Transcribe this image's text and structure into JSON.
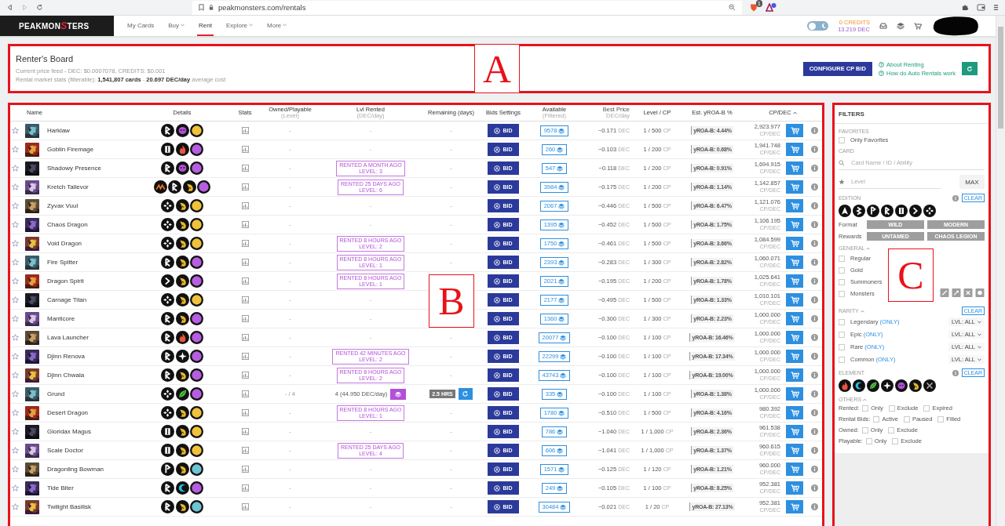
{
  "browser": {
    "url": "peakmonsters.com/rentals",
    "forward_disabled": true,
    "shield_badge": "1"
  },
  "nav": {
    "logo": {
      "before": "PEAKMON",
      "mark": "S",
      "after": "TERS"
    },
    "items": [
      {
        "label": "My Cards",
        "dropdown": false,
        "selected": false
      },
      {
        "label": "Buy",
        "dropdown": true,
        "selected": false
      },
      {
        "label": "Rent",
        "dropdown": false,
        "selected": true
      },
      {
        "label": "Explore",
        "dropdown": true,
        "selected": false
      },
      {
        "label": "More",
        "dropdown": true,
        "selected": false
      }
    ],
    "theme_toggle_on": false,
    "credits": "0 CREDITS",
    "dec": "13.219 DEC"
  },
  "board": {
    "annotation": "A",
    "title": "Renter's Board",
    "price_feed": "Current price feed - DEC: $0.0007078, CREDITS: $0.001",
    "market_stats": "Rental market stats (filterable): **1,541,807 cards** - **20.697 DEC/day** average cost",
    "configure_button": "CONFIGURE CP BID",
    "links": [
      "About Renting",
      "How do Auto Rentals work"
    ]
  },
  "table": {
    "annotation": "B",
    "columns": [
      {
        "label": "Name",
        "sorted": false
      },
      {
        "label": "Details",
        "sorted": false
      },
      {
        "label": "Stats",
        "sorted": false
      },
      {
        "label": "Owned/Playable",
        "sub": "(Level)",
        "sorted": false
      },
      {
        "label": "Lvl Rented",
        "sub": "(DEC/day)",
        "sorted": false
      },
      {
        "label": "Remaining (days)",
        "sorted": false
      },
      {
        "label": "Bids Settings",
        "sorted": false
      },
      {
        "label": "Available",
        "sub": "(Filtered)",
        "sorted": false
      },
      {
        "label": "Best Price",
        "sub": "DEC/day",
        "sorted": false
      },
      {
        "label": "Level / CP",
        "sorted": false
      },
      {
        "label": "Est. yROA-B %",
        "sorted": false
      },
      {
        "label": "CP/DEC",
        "sorted": true
      }
    ],
    "rows": [
      {
        "favorite": false,
        "name": "Harklaw",
        "details": [
          {
            "kind": "rune"
          },
          {
            "kind": "death"
          },
          {
            "kind": "rarity",
            "color": "#f0c23b"
          }
        ],
        "owned": "-",
        "rented": {
          "kind": "none",
          "text": "-"
        },
        "remaining": {
          "kind": "none",
          "text": "-"
        },
        "bid": "BID",
        "available": "9578",
        "price": "~0.171",
        "price_unit": "DEC",
        "level_cp": "1 / 500",
        "level_unit": "CP",
        "yroa": "yROA-B: 4.44%",
        "cp_dec": "2,923.977",
        "cp_dec_unit": "CP/DEC"
      },
      {
        "favorite": false,
        "name": "Goblin Firemage",
        "details": [
          {
            "kind": "bars"
          },
          {
            "kind": "fire"
          },
          {
            "kind": "rarity",
            "color": "#b65ee0"
          }
        ],
        "owned": "-",
        "rented": {
          "kind": "none",
          "text": "-"
        },
        "remaining": {
          "kind": "none",
          "text": "-"
        },
        "bid": "BID",
        "available": "260",
        "price": "~0.103",
        "price_unit": "DEC",
        "level_cp": "1 / 200",
        "level_unit": "CP",
        "yroa": "yROA-B: 0.68%",
        "cp_dec": "1,941.748",
        "cp_dec_unit": "CP/DEC"
      },
      {
        "favorite": false,
        "name": "Shadowy Presence",
        "details": [
          {
            "kind": "rune"
          },
          {
            "kind": "death"
          },
          {
            "kind": "rarity",
            "color": "#b65ee0"
          }
        ],
        "owned": "-",
        "rented": {
          "kind": "badge",
          "text": "RENTED A MONTH AGO",
          "detail": "LEVEL: 3"
        },
        "remaining": {
          "kind": "none",
          "text": "-"
        },
        "bid": "BID",
        "available": "547",
        "price": "~0.118",
        "price_unit": "DEC",
        "level_cp": "1 / 200",
        "level_unit": "CP",
        "yroa": "yROA-B: 0.91%",
        "cp_dec": "1,694.915",
        "cp_dec_unit": "CP/DEC"
      },
      {
        "favorite": false,
        "name": "Kretch Tallevor",
        "details": [
          {
            "kind": "tribal"
          },
          {
            "kind": "rune"
          },
          {
            "kind": "dragon"
          },
          {
            "kind": "rarity",
            "color": "#b65ee0"
          }
        ],
        "owned": "-",
        "rented": {
          "kind": "badge",
          "text": "RENTED 25 DAYS AGO",
          "detail": "LEVEL: 6"
        },
        "remaining": {
          "kind": "none",
          "text": "-"
        },
        "bid": "BID",
        "available": "3984",
        "price": "~0.175",
        "price_unit": "DEC",
        "level_cp": "1 / 200",
        "level_unit": "CP",
        "yroa": "yROA-B: 1.14%",
        "cp_dec": "1,142.857",
        "cp_dec_unit": "CP/DEC"
      },
      {
        "favorite": false,
        "name": "Zyvax Vuul",
        "details": [
          {
            "kind": "diamond"
          },
          {
            "kind": "dragon"
          },
          {
            "kind": "rarity",
            "color": "#f0c23b"
          }
        ],
        "owned": "-",
        "rented": {
          "kind": "none",
          "text": "-"
        },
        "remaining": {
          "kind": "none",
          "text": "-"
        },
        "bid": "BID",
        "available": "2067",
        "price": "~0.446",
        "price_unit": "DEC",
        "level_cp": "1 / 500",
        "level_unit": "CP",
        "yroa": "yROA-B: 6.47%",
        "cp_dec": "1,121.076",
        "cp_dec_unit": "CP/DEC"
      },
      {
        "favorite": false,
        "name": "Chaos Dragon",
        "details": [
          {
            "kind": "diamond"
          },
          {
            "kind": "dragon"
          },
          {
            "kind": "rarity",
            "color": "#f0c23b"
          }
        ],
        "owned": "-",
        "rented": {
          "kind": "none",
          "text": "-"
        },
        "remaining": {
          "kind": "none",
          "text": "-"
        },
        "bid": "BID",
        "available": "1395",
        "price": "~0.452",
        "price_unit": "DEC",
        "level_cp": "1 / 500",
        "level_unit": "CP",
        "yroa": "yROA-B: 1.75%",
        "cp_dec": "1,106.195",
        "cp_dec_unit": "CP/DEC"
      },
      {
        "favorite": false,
        "name": "Void Dragon",
        "details": [
          {
            "kind": "diamond"
          },
          {
            "kind": "dragon"
          },
          {
            "kind": "rarity",
            "color": "#f0c23b"
          }
        ],
        "owned": "-",
        "rented": {
          "kind": "badge",
          "text": "RENTED 8 HOURS AGO",
          "detail": "LEVEL: 2"
        },
        "remaining": {
          "kind": "none",
          "text": "-"
        },
        "bid": "BID",
        "available": "1750",
        "price": "~0.461",
        "price_unit": "DEC",
        "level_cp": "1 / 500",
        "level_unit": "CP",
        "yroa": "yROA-B: 3.66%",
        "cp_dec": "1,084.599",
        "cp_dec_unit": "CP/DEC"
      },
      {
        "favorite": false,
        "name": "Fire Spitter",
        "details": [
          {
            "kind": "rune"
          },
          {
            "kind": "dragon"
          },
          {
            "kind": "rarity",
            "color": "#b65ee0"
          }
        ],
        "owned": "-",
        "rented": {
          "kind": "badge",
          "text": "RENTED 8 HOURS AGO",
          "detail": "LEVEL: 1"
        },
        "remaining": {
          "kind": "none",
          "text": "-"
        },
        "bid": "BID",
        "available": "2393",
        "price": "~0.283",
        "price_unit": "DEC",
        "level_cp": "1 / 300",
        "level_unit": "CP",
        "yroa": "yROA-B: 2.82%",
        "cp_dec": "1,060.071",
        "cp_dec_unit": "CP/DEC"
      },
      {
        "favorite": false,
        "name": "Dragon Spirit",
        "details": [
          {
            "kind": "chevron"
          },
          {
            "kind": "dragon"
          },
          {
            "kind": "rarity",
            "color": "#b65ee0"
          }
        ],
        "owned": "-",
        "rented": {
          "kind": "badge",
          "text": "RENTED 8 HOURS AGO",
          "detail": "LEVEL: 1"
        },
        "remaining": {
          "kind": "hidden"
        },
        "bid": "BID",
        "available": "2021",
        "price": "~0.195",
        "price_unit": "DEC",
        "level_cp": "1 / 200",
        "level_unit": "CP",
        "yroa": "yROA-B: 1.78%",
        "cp_dec": "1,025.641",
        "cp_dec_unit": "CP/DEC"
      },
      {
        "favorite": false,
        "name": "Carnage Titan",
        "details": [
          {
            "kind": "diamond"
          },
          {
            "kind": "dragon"
          },
          {
            "kind": "rarity",
            "color": "#f0c23b"
          }
        ],
        "owned": "-",
        "rented": {
          "kind": "none",
          "text": "-"
        },
        "remaining": {
          "kind": "hidden"
        },
        "bid": "BID",
        "available": "2177",
        "price": "~0.495",
        "price_unit": "DEC",
        "level_cp": "1 / 500",
        "level_unit": "CP",
        "yroa": "yROA-B: 1.33%",
        "cp_dec": "1,010.101",
        "cp_dec_unit": "CP/DEC"
      },
      {
        "favorite": false,
        "name": "Manticore",
        "details": [
          {
            "kind": "rune"
          },
          {
            "kind": "dragon"
          },
          {
            "kind": "rarity",
            "color": "#b65ee0"
          }
        ],
        "owned": "-",
        "rented": {
          "kind": "none",
          "text": "-"
        },
        "remaining": {
          "kind": "hidden"
        },
        "bid": "BID",
        "available": "1360",
        "price": "~0.300",
        "price_unit": "DEC",
        "level_cp": "1 / 300",
        "level_unit": "CP",
        "yroa": "yROA-B: 2.23%",
        "cp_dec": "1,000.000",
        "cp_dec_unit": "CP/DEC"
      },
      {
        "favorite": false,
        "name": "Lava Launcher",
        "details": [
          {
            "kind": "rune"
          },
          {
            "kind": "fire"
          },
          {
            "kind": "rarity",
            "color": "#b65ee0"
          }
        ],
        "owned": "-",
        "rented": {
          "kind": "none",
          "text": "-"
        },
        "remaining": {
          "kind": "none",
          "text": "-"
        },
        "bid": "BID",
        "available": "20077",
        "price": "~0.100",
        "price_unit": "DEC",
        "level_cp": "1 / 100",
        "level_unit": "CP",
        "yroa": "yROA-B: 16.46%",
        "cp_dec": "1,000.000",
        "cp_dec_unit": "CP/DEC"
      },
      {
        "favorite": false,
        "name": "Djinn Renova",
        "details": [
          {
            "kind": "rune"
          },
          {
            "kind": "life"
          },
          {
            "kind": "rarity",
            "color": "#b65ee0"
          }
        ],
        "owned": "-",
        "rented": {
          "kind": "badge",
          "text": "RENTED 42 MINUTES AGO",
          "detail": "LEVEL: 2"
        },
        "remaining": {
          "kind": "none",
          "text": "-"
        },
        "bid": "BID",
        "available": "22299",
        "price": "~0.100",
        "price_unit": "DEC",
        "level_cp": "1 / 100",
        "level_unit": "CP",
        "yroa": "yROA-B: 17.34%",
        "cp_dec": "1,000.000",
        "cp_dec_unit": "CP/DEC"
      },
      {
        "favorite": false,
        "name": "Djinn Chwala",
        "details": [
          {
            "kind": "rune"
          },
          {
            "kind": "dragon"
          },
          {
            "kind": "rarity",
            "color": "#b65ee0"
          }
        ],
        "owned": "-",
        "rented": {
          "kind": "badge",
          "text": "RENTED 8 HOURS AGO",
          "detail": "LEVEL: 2"
        },
        "remaining": {
          "kind": "none",
          "text": "-"
        },
        "bid": "BID",
        "available": "43743",
        "price": "~0.100",
        "price_unit": "DEC",
        "level_cp": "1 / 100",
        "level_unit": "CP",
        "yroa": "yROA-B: 19.00%",
        "cp_dec": "1,000.000",
        "cp_dec_unit": "CP/DEC"
      },
      {
        "favorite": false,
        "name": "Grund",
        "details": [
          {
            "kind": "diamond"
          },
          {
            "kind": "earth"
          },
          {
            "kind": "rarity",
            "color": "#b65ee0"
          }
        ],
        "owned": "- / 4",
        "rented": {
          "kind": "price",
          "text": "4 (44.950 DEC/day)"
        },
        "remaining": {
          "kind": "timer",
          "text": "2.5 HRS"
        },
        "bid": "BID",
        "available": "335",
        "price": "~0.100",
        "price_unit": "DEC",
        "level_cp": "1 / 100",
        "level_unit": "CP",
        "yroa": "yROA-B: 1.38%",
        "cp_dec": "1,000.000",
        "cp_dec_unit": "CP/DEC"
      },
      {
        "favorite": false,
        "name": "Desert Dragon",
        "details": [
          {
            "kind": "diamond"
          },
          {
            "kind": "dragon"
          },
          {
            "kind": "rarity",
            "color": "#f0c23b"
          }
        ],
        "owned": "-",
        "rented": {
          "kind": "badge",
          "text": "RENTED 8 HOURS AGO",
          "detail": "LEVEL: 1"
        },
        "remaining": {
          "kind": "none",
          "text": "-"
        },
        "bid": "BID",
        "available": "1780",
        "price": "~0.510",
        "price_unit": "DEC",
        "level_cp": "1 / 500",
        "level_unit": "CP",
        "yroa": "yROA-B: 4.16%",
        "cp_dec": "980.392",
        "cp_dec_unit": "CP/DEC"
      },
      {
        "favorite": false,
        "name": "Gloridax Magus",
        "details": [
          {
            "kind": "bars"
          },
          {
            "kind": "dragon"
          },
          {
            "kind": "rarity",
            "color": "#f0c23b"
          }
        ],
        "owned": "-",
        "rented": {
          "kind": "none",
          "text": "-"
        },
        "remaining": {
          "kind": "none",
          "text": "-"
        },
        "bid": "BID",
        "available": "786",
        "price": "~1.040",
        "price_unit": "DEC",
        "level_cp": "1 / 1,000",
        "level_unit": "CP",
        "yroa": "yROA-B: 2.36%",
        "cp_dec": "961.538",
        "cp_dec_unit": "CP/DEC"
      },
      {
        "favorite": false,
        "name": "Scale Doctor",
        "details": [
          {
            "kind": "bars"
          },
          {
            "kind": "dragon"
          },
          {
            "kind": "rarity",
            "color": "#f0c23b"
          }
        ],
        "owned": "-",
        "rented": {
          "kind": "badge",
          "text": "RENTED 25 DAYS AGO",
          "detail": "LEVEL: 4"
        },
        "remaining": {
          "kind": "none",
          "text": "-"
        },
        "bid": "BID",
        "available": "606",
        "price": "~1.041",
        "price_unit": "DEC",
        "level_cp": "1 / 1,000",
        "level_unit": "CP",
        "yroa": "yROA-B: 1.37%",
        "cp_dec": "960.615",
        "cp_dec_unit": "CP/DEC"
      },
      {
        "favorite": false,
        "name": "Dragonling Bowman",
        "details": [
          {
            "kind": "flag"
          },
          {
            "kind": "dragon"
          },
          {
            "kind": "rarity",
            "color": "#6cc4d4"
          }
        ],
        "owned": "-",
        "rented": {
          "kind": "none",
          "text": "-"
        },
        "remaining": {
          "kind": "none",
          "text": "-"
        },
        "bid": "BID",
        "available": "1571",
        "price": "~0.125",
        "price_unit": "DEC",
        "level_cp": "1 / 120",
        "level_unit": "CP",
        "yroa": "yROA-B: 1.21%",
        "cp_dec": "960.000",
        "cp_dec_unit": "CP/DEC"
      },
      {
        "favorite": false,
        "name": "Tide Biter",
        "details": [
          {
            "kind": "rune"
          },
          {
            "kind": "water"
          },
          {
            "kind": "rarity",
            "color": "#b65ee0"
          }
        ],
        "owned": "-",
        "rented": {
          "kind": "none",
          "text": "-"
        },
        "remaining": {
          "kind": "none",
          "text": "-"
        },
        "bid": "BID",
        "available": "249",
        "price": "~0.105",
        "price_unit": "DEC",
        "level_cp": "1 / 100",
        "level_unit": "CP",
        "yroa": "yROA-B: 8.25%",
        "cp_dec": "952.381",
        "cp_dec_unit": "CP/DEC"
      },
      {
        "favorite": false,
        "name": "Twilight Basilisk",
        "details": [
          {
            "kind": "rune"
          },
          {
            "kind": "dragon"
          },
          {
            "kind": "rarity",
            "color": "#6cc4d4"
          }
        ],
        "owned": "-",
        "rented": {
          "kind": "none",
          "text": "-"
        },
        "remaining": {
          "kind": "none",
          "text": "-"
        },
        "bid": "BID",
        "available": "30484",
        "price": "~0.021",
        "price_unit": "DEC",
        "level_cp": "1 / 20",
        "level_unit": "CP",
        "yroa": "yROA-B: 27.13%",
        "cp_dec": "952.381",
        "cp_dec_unit": "CP/DEC"
      }
    ]
  },
  "filters": {
    "annotation": "C",
    "title": "FILTERS",
    "favorites": {
      "heading": "FAVORITES",
      "options": [
        {
          "label": "Only Favorites",
          "checked": false
        }
      ]
    },
    "card": {
      "heading": "CARD",
      "search_placeholder": "Card Name / ID / Ability",
      "level_placeholder": "Level",
      "max_button": "MAX"
    },
    "edition": {
      "heading": "EDITION",
      "clear": "CLEAR",
      "icons": [
        {
          "kind": "triangle"
        },
        {
          "kind": "zigzag"
        },
        {
          "kind": "flag"
        },
        {
          "kind": "rune"
        },
        {
          "kind": "bars"
        },
        {
          "kind": "chevron"
        },
        {
          "kind": "diamond"
        }
      ],
      "format_label": "Format",
      "formats": [
        {
          "label": "WILD",
          "selected": false
        },
        {
          "label": "MODERN",
          "selected": false
        }
      ],
      "rewards_label": "Rewards",
      "rewards": [
        {
          "label": "UNTAMED",
          "selected": false
        },
        {
          "label": "CHAOS LEGION",
          "selected": false
        }
      ]
    },
    "general": {
      "heading": "GENERAL",
      "expanded": true,
      "options": [
        {
          "label": "Regular",
          "checked": false
        },
        {
          "label": "Gold",
          "checked": false
        },
        {
          "label": "Summoners",
          "checked": false
        },
        {
          "label": "Monsters",
          "checked": false
        }
      ],
      "icons": [
        {
          "kind": "sword"
        },
        {
          "kind": "arrow"
        },
        {
          "kind": "cross"
        },
        {
          "kind": "shield"
        }
      ]
    },
    "rarity": {
      "heading": "RARITY",
      "expanded": true,
      "clear": "CLEAR",
      "options": [
        {
          "label": "Legendary",
          "only": "(ONLY)",
          "checked": false,
          "lvl": "LVL: ALL"
        },
        {
          "label": "Epic",
          "only": "(ONLY)",
          "checked": false,
          "lvl": "LVL: ALL"
        },
        {
          "label": "Rare",
          "only": "(ONLY)",
          "checked": false,
          "lvl": "LVL: ALL"
        },
        {
          "label": "Common",
          "only": "(ONLY)",
          "checked": false,
          "lvl": "LVL: ALL"
        }
      ]
    },
    "element": {
      "heading": "ELEMENT",
      "clear": "CLEAR",
      "icons": [
        {
          "kind": "fire"
        },
        {
          "kind": "water"
        },
        {
          "kind": "earth"
        },
        {
          "kind": "life"
        },
        {
          "kind": "death"
        },
        {
          "kind": "dragon"
        },
        {
          "kind": "neutral"
        }
      ]
    },
    "others": {
      "heading": "OTHERS",
      "expanded": true,
      "groups": [
        {
          "label": "Rented:",
          "options": [
            {
              "label": "Only",
              "checked": false
            },
            {
              "label": "Exclude",
              "checked": false
            },
            {
              "label": "Expired",
              "checked": false
            }
          ]
        },
        {
          "label": "Rental Bids:",
          "options": [
            {
              "label": "Active",
              "checked": false
            },
            {
              "label": "Paused",
              "checked": false
            },
            {
              "label": "Filled",
              "checked": false
            }
          ]
        },
        {
          "label": "Owned:",
          "options": [
            {
              "label": "Only",
              "checked": false
            },
            {
              "label": "Exclude",
              "checked": false
            }
          ]
        },
        {
          "label": "Playable:",
          "options": [
            {
              "label": "Only",
              "checked": false
            },
            {
              "label": "Exclude",
              "checked": false
            }
          ]
        }
      ]
    }
  }
}
